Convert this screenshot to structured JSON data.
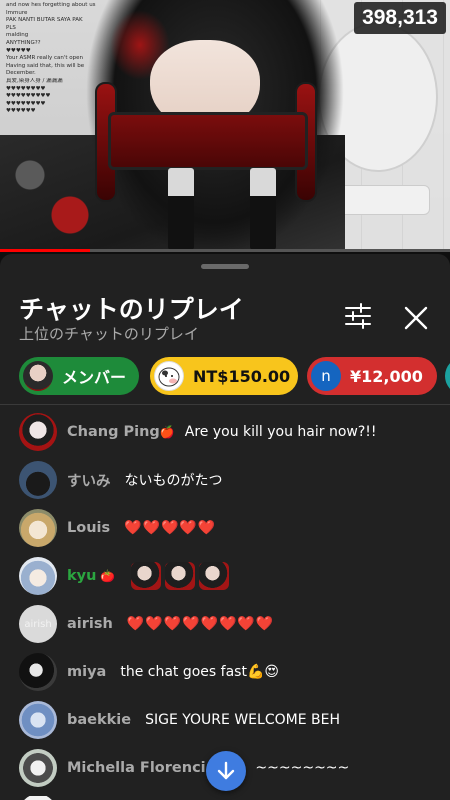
{
  "video": {
    "viewer_count": "398,313",
    "progress_fraction": 0.2,
    "overlay_chat_lines": [
      "and now hes forgetting about us",
      "Immure",
      "PAK NANTI BUTAR SAYA PAK",
      "PLS",
      "malding",
      "ANYTHING??",
      "♥♥♥♥♥",
      "Your ASMR really can't open",
      "Having said that, this will be",
      "December.",
      "真爱,染身人身 / 漏漏漏",
      "♥♥♥♥♥♥♥♥",
      "♥♥♥♥♥♥♥♥♥",
      "♥♥♥♥♥♥♥♥",
      "♥♥♥♥♥♥"
    ]
  },
  "sheet": {
    "title": "チャットのリプレイ",
    "subtitle": "上位のチャットのリプレイ"
  },
  "chips": [
    {
      "label": "メンバー",
      "color": "#1e8b3a"
    },
    {
      "label": "NT$150.00",
      "color": "#f8c51c"
    },
    {
      "label": "¥12,000",
      "avatar_letter": "n",
      "color": "#d32f2f"
    }
  ],
  "messages": [
    {
      "author": "Chang Ping",
      "badge": "🍎",
      "text": "Are you kill you hair now?!!",
      "avatar_color": "#e6e0e0"
    },
    {
      "author": "すいみ",
      "text": "ないものがたつ",
      "avatar_color": "#2c3e58"
    },
    {
      "author": "Louis",
      "text": "❤️❤️❤️❤️❤️",
      "avatar_color": "#c9b38a"
    },
    {
      "author": "kyu",
      "member": true,
      "badge": "🍅",
      "text": "",
      "stickers": 3,
      "avatar_color": "#dde6f2"
    },
    {
      "author": "airish",
      "text": "❤️❤️❤️❤️❤️❤️❤️❤️",
      "avatar_color": "#d8d8d8",
      "avatar_text": "airish"
    },
    {
      "author": "miya",
      "text": "the chat goes fast💪😍",
      "avatar_color": "#2a2a2a"
    },
    {
      "author": "baekkie",
      "text": "SIGE YOURE WELCOME BEH",
      "avatar_color": "#5b7fb5"
    },
    {
      "author": "Michella Florencia",
      "text": "~~~~~~~~",
      "avatar_color": "#cfd6cf"
    }
  ],
  "colors": {
    "sheet_bg": "#212121",
    "accent_blue": "#3f7ce0",
    "member_green": "#2ba640"
  }
}
